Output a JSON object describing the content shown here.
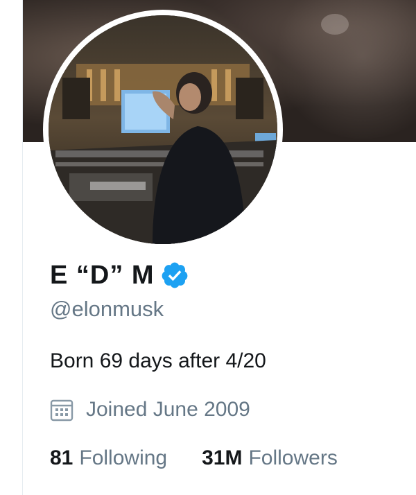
{
  "profile": {
    "display_name": "E “D” M",
    "handle": "@elonmusk",
    "bio": "Born 69 days after 4/20",
    "joined": "Joined June 2009",
    "verified_color": "#1da1f2"
  },
  "stats": {
    "following_count": "81",
    "following_label": "Following",
    "followers_count": "31M",
    "followers_label": "Followers"
  },
  "icons": {
    "verified": "verified-badge-icon",
    "calendar": "calendar-icon"
  }
}
